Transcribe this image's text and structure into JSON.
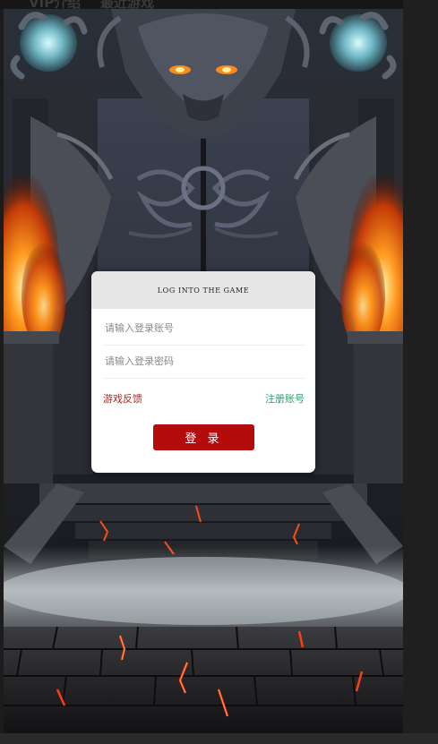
{
  "top_tabs": [
    {
      "label": "VIP介绍"
    },
    {
      "label": "最近游戏"
    }
  ],
  "login": {
    "title": "LOG INTO THE GAME",
    "account_placeholder": "请输入登录账号",
    "password_placeholder": "请输入登录密码",
    "feedback_link": "游戏反馈",
    "register_link": "注册账号",
    "login_button": "登 录"
  },
  "colors": {
    "button_red": "#b40c0c",
    "feedback_red": "#a82626",
    "register_green": "#2a9d6e",
    "header_gray": "#e6e6e6"
  },
  "background": {
    "description_icon": "dragon-gate-scene"
  }
}
